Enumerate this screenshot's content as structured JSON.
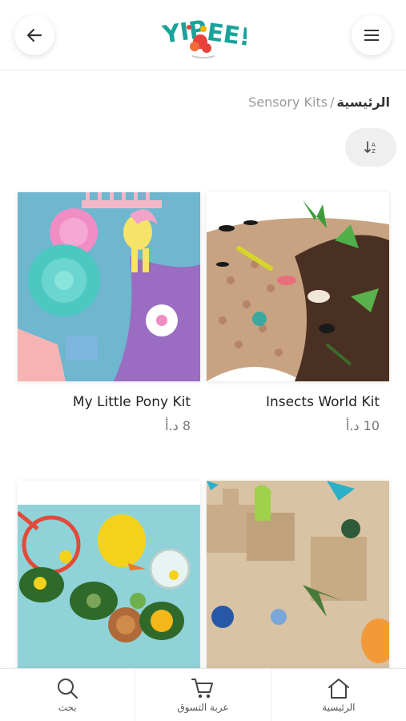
{
  "header": {
    "logo_text": "YIPPEE!",
    "back_icon": "arrow-left-icon",
    "menu_icon": "hamburger-menu-icon"
  },
  "breadcrumb": {
    "home": "الرئيسية",
    "separator": "/",
    "current": "Sensory Kits"
  },
  "sort": {
    "icon": "sort-icon"
  },
  "products": [
    {
      "name": "Insects World Kit",
      "price": "10 د.أ"
    },
    {
      "name": "My Little Pony Kit",
      "price": "8 د.أ"
    },
    {
      "name": "",
      "price": ""
    },
    {
      "name": "",
      "price": ""
    }
  ],
  "bottom_nav": {
    "items": [
      {
        "label": "بحث",
        "icon": "search-icon"
      },
      {
        "label": "عربة التسوق",
        "icon": "cart-icon"
      },
      {
        "label": "الرئيسية",
        "icon": "home-icon"
      }
    ]
  },
  "colors": {
    "logo_teal": "#1aa39a",
    "logo_red": "#e8423a",
    "logo_yellow": "#f4b400"
  }
}
